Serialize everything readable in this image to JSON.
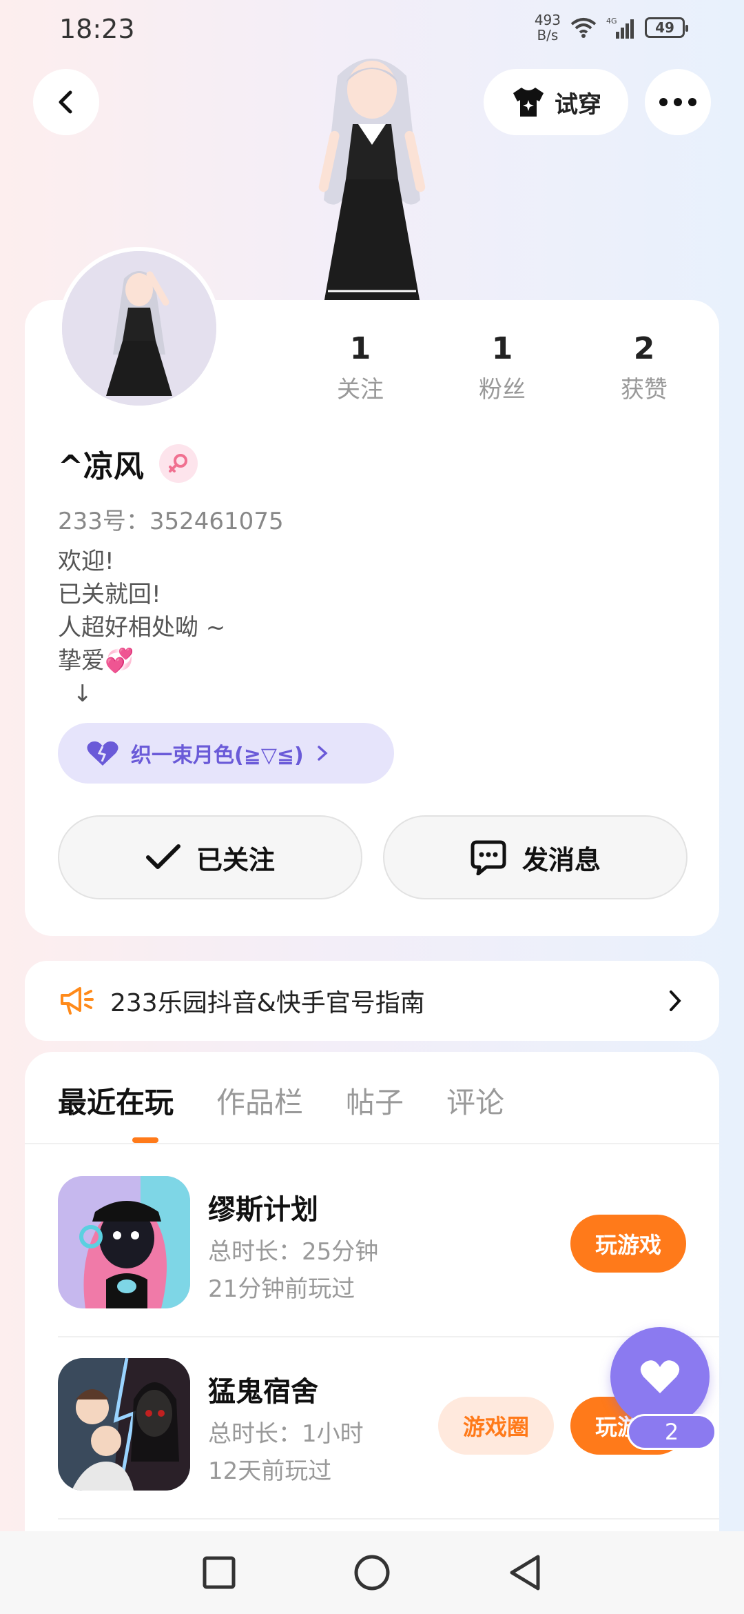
{
  "status": {
    "time": "18:23",
    "net_speed_value": "493",
    "net_speed_unit": "B/s",
    "network": "4G",
    "battery": "49"
  },
  "header": {
    "tryon_label": "试穿"
  },
  "profile": {
    "stats": [
      {
        "value": "1",
        "label": "关注"
      },
      {
        "value": "1",
        "label": "粉丝"
      },
      {
        "value": "2",
        "label": "获赞"
      }
    ],
    "nickname": "^凉风",
    "user_id": "233号：352461075",
    "bio": "欢迎!\n已关就回!\n人超好相处呦 ~\n挚爱💞\n  ↓",
    "badge_label": "织一束月色(≧▽≦)",
    "follow_label": "已关注",
    "message_label": "发消息"
  },
  "notice": {
    "text": "233乐园抖音&快手官号指南"
  },
  "tabs": [
    "最近在玩",
    "作品栏",
    "帖子",
    "评论"
  ],
  "games": [
    {
      "name": "缪斯计划",
      "duration": "总时长：25分钟",
      "last_played": "21分钟前玩过",
      "play_label": "玩游戏"
    },
    {
      "name": "猛鬼宿舍",
      "duration": "总时长：1小时",
      "last_played": "12天前玩过",
      "play_label": "玩游戏",
      "circle_label": "游戏圈"
    }
  ],
  "like_count": "2",
  "colors": {
    "accent": "#ff7a1a",
    "purple": "#8b7af0"
  }
}
